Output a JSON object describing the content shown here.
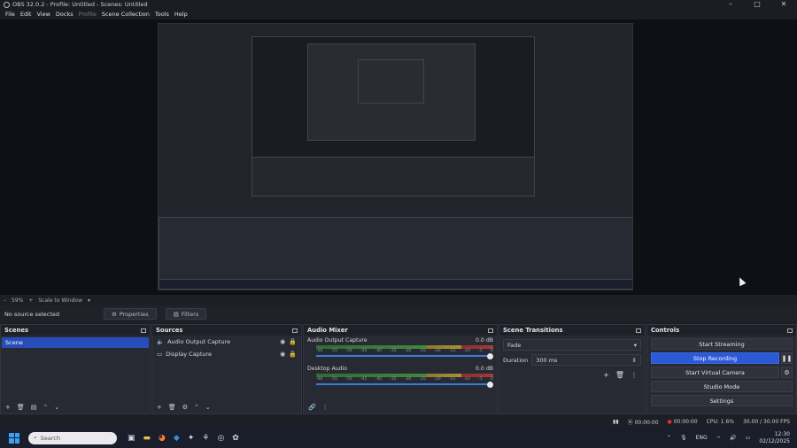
{
  "window": {
    "title": "OBS 32.0.2 - Profile: Untitled - Scenes: Untitled"
  },
  "menu": {
    "items": [
      "File",
      "Edit",
      "View",
      "Docks",
      "Profile",
      "Scene Collection",
      "Tools",
      "Help"
    ]
  },
  "preview": {
    "zoom": "59%",
    "scale_mode": "Scale to Window"
  },
  "source_bar": {
    "status": "No source selected",
    "properties": "Properties",
    "filters": "Filters"
  },
  "scenes": {
    "title": "Scenes",
    "items": [
      "Scene"
    ]
  },
  "sources": {
    "title": "Sources",
    "items": [
      "Audio Output Capture",
      "Display Capture"
    ]
  },
  "mixer": {
    "title": "Audio Mixer",
    "ticks": [
      "-60",
      "-55",
      "-50",
      "-45",
      "-40",
      "-35",
      "-30",
      "-25",
      "-20",
      "-15",
      "-10",
      "-5",
      "0"
    ],
    "channels": [
      {
        "name": "Audio Output Capture",
        "db": "0.0 dB",
        "level": 1.0
      },
      {
        "name": "Desktop Audio",
        "db": "0.0 dB",
        "level": 1.0
      }
    ]
  },
  "transitions": {
    "title": "Scene Transitions",
    "type": "Fade",
    "duration_label": "Duration",
    "duration_value": "300 ms"
  },
  "controls": {
    "title": "Controls",
    "buttons": [
      "Start Streaming",
      "Stop Recording",
      "Start Virtual Camera",
      "Studio Mode",
      "Settings"
    ]
  },
  "status": {
    "stream_time": "00:00:00",
    "rec_time": "00:00:00",
    "cpu": "CPU: 1.6%",
    "fps": "30.00 / 30.00 FPS"
  },
  "taskbar": {
    "search_placeholder": "Search",
    "lang": "ENG",
    "time": "12:30",
    "date": "02/12/2025"
  },
  "colors": {
    "accent": "#2c59d6",
    "scene_selected": "#284cb8",
    "record": "#e03030"
  }
}
